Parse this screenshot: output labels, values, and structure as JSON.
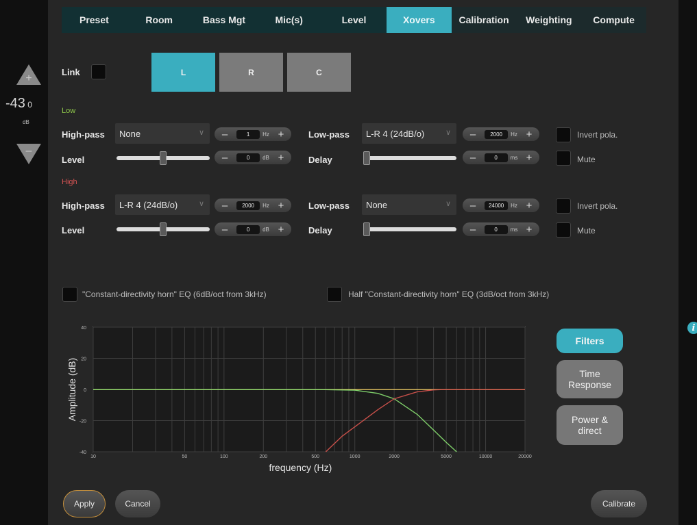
{
  "tabs": [
    {
      "label": "Preset"
    },
    {
      "label": "Room"
    },
    {
      "label": "Bass Mgt"
    },
    {
      "label": "Mic(s)"
    },
    {
      "label": "Level"
    },
    {
      "label": "Xovers",
      "active": true
    },
    {
      "label": "Calibration"
    },
    {
      "label": "Weighting"
    },
    {
      "label": "Compute"
    }
  ],
  "volume": {
    "value": "-43",
    "decimal": "0",
    "unit": "dB"
  },
  "link_label": "Link",
  "channels": [
    {
      "label": "L",
      "active": true
    },
    {
      "label": "R"
    },
    {
      "label": "C"
    }
  ],
  "low": {
    "section_label": "Low",
    "highpass": {
      "label": "High-pass",
      "type": "None",
      "freq": "1",
      "unit": "Hz"
    },
    "lowpass": {
      "label": "Low-pass",
      "type": "L-R 4 (24dB/o)",
      "freq": "2000",
      "unit": "Hz"
    },
    "invert_label": "Invert pola.",
    "level": {
      "label": "Level",
      "value": "0",
      "unit": "dB",
      "slider_fraction": 0.49
    },
    "delay": {
      "label": "Delay",
      "value": "0",
      "unit": "ms",
      "slider_fraction": 0.0
    },
    "mute_label": "Mute"
  },
  "high": {
    "section_label": "High",
    "highpass": {
      "label": "High-pass",
      "type": "L-R 4 (24dB/o)",
      "freq": "2000",
      "unit": "Hz"
    },
    "lowpass": {
      "label": "Low-pass",
      "type": "None",
      "freq": "24000",
      "unit": "Hz"
    },
    "invert_label": "Invert pola.",
    "level": {
      "label": "Level",
      "value": "0",
      "unit": "dB",
      "slider_fraction": 0.49
    },
    "delay": {
      "label": "Delay",
      "value": "0",
      "unit": "ms",
      "slider_fraction": 0.0
    },
    "mute_label": "Mute"
  },
  "eq_options": {
    "cd_horn": "\"Constant-directivity horn\" EQ (6dB/oct from 3kHz)",
    "half_cd_horn": "Half \"Constant-directivity horn\" EQ (3dB/oct from 3kHz)"
  },
  "chart_data": {
    "type": "line",
    "xlabel": "frequency (Hz)",
    "ylabel": "Amplitude (dB)",
    "xscale": "log",
    "xlim": [
      10,
      20000
    ],
    "ylim": [
      -40,
      40
    ],
    "xticks": [
      10,
      50,
      100,
      200,
      500,
      1000,
      2000,
      5000,
      10000,
      20000
    ],
    "yticks": [
      40,
      20,
      0,
      -20,
      -40
    ],
    "grid": true,
    "series": [
      {
        "color": "#e0c060",
        "x": [
          10,
          20000
        ],
        "y": [
          0,
          0
        ]
      },
      {
        "color": "#7fcf6a",
        "x": [
          10,
          500,
          1000,
          1500,
          2000,
          3000,
          4000,
          5000,
          6000
        ],
        "y": [
          0,
          0,
          -0.5,
          -2.5,
          -6,
          -16,
          -26,
          -34,
          -40
        ]
      },
      {
        "color": "#c8504a",
        "x": [
          600,
          800,
          1000,
          1500,
          2000,
          3000,
          4000,
          5000,
          20000
        ],
        "y": [
          -40,
          -30,
          -24,
          -13,
          -6,
          -1.5,
          -0.3,
          0,
          0
        ]
      }
    ]
  },
  "view_buttons": {
    "filters": "Filters",
    "time": "Time Response",
    "power": "Power & direct"
  },
  "actions": {
    "apply": "Apply",
    "cancel": "Cancel",
    "calibrate": "Calibrate"
  },
  "info_glyph": "i",
  "colors": {
    "accent": "#3aaebf",
    "low": "#8ec74a",
    "high": "#d45353",
    "apply_border": "#c7913c"
  }
}
